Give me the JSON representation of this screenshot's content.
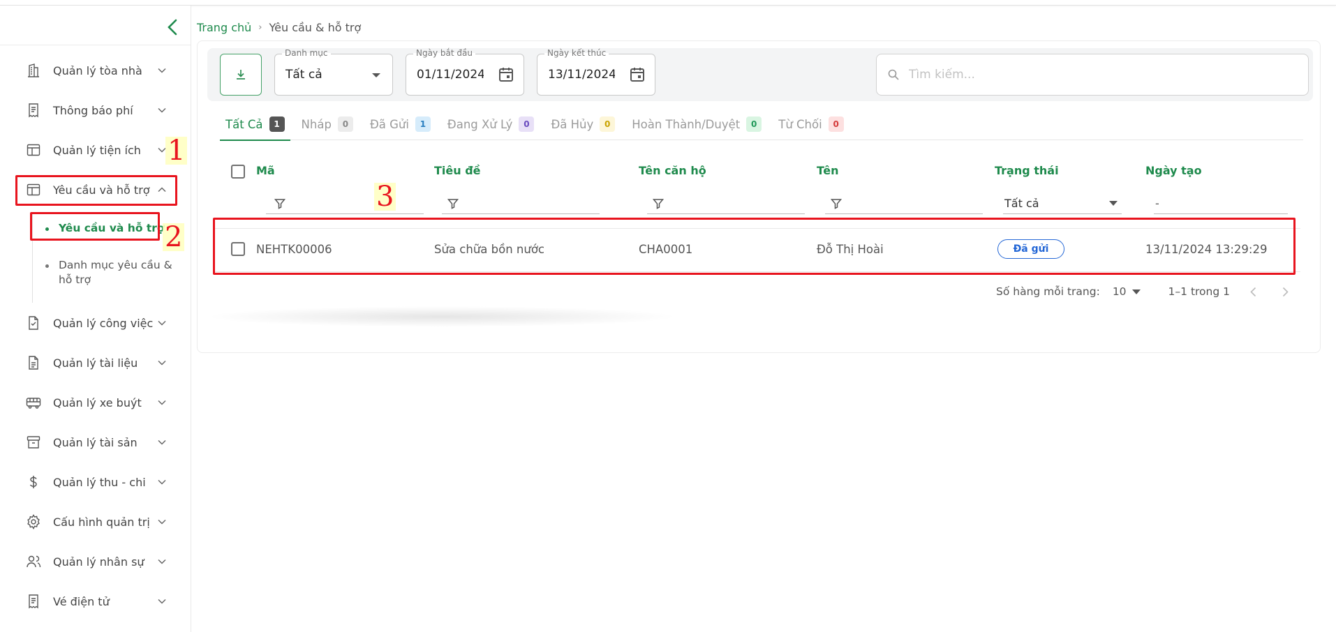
{
  "sidebar": {
    "items": [
      {
        "label": "Quản lý tòa nhà",
        "icon": "building-icon"
      },
      {
        "label": "Thông báo phí",
        "icon": "receipt-icon"
      },
      {
        "label": "Quản lý tiện ích",
        "icon": "layout-icon"
      },
      {
        "label": "Yêu cầu và hỗ trợ",
        "icon": "layout-icon"
      },
      {
        "label": "Quản lý công việc",
        "icon": "file-check-icon"
      },
      {
        "label": "Quản lý tài liệu",
        "icon": "document-icon"
      },
      {
        "label": "Quản lý xe buýt",
        "icon": "bus-icon"
      },
      {
        "label": "Quản lý tài sản",
        "icon": "archive-icon"
      },
      {
        "label": "Quản lý thu - chi",
        "icon": "dollar-icon"
      },
      {
        "label": "Cấu hình quản trị",
        "icon": "gear-icon"
      },
      {
        "label": "Quản lý nhân sự",
        "icon": "users-icon"
      },
      {
        "label": "Vé điện tử",
        "icon": "receipt-icon"
      }
    ],
    "sub_items": [
      {
        "label": "Yêu cầu và hỗ trợ",
        "active": true
      },
      {
        "label": "Danh mục yêu cầu & hỗ trợ",
        "active": false
      }
    ]
  },
  "annotations": [
    "1",
    "2",
    "3"
  ],
  "breadcrumb": {
    "home": "Trang chủ",
    "separator": "›",
    "current": "Yêu cầu & hỗ trợ"
  },
  "filters": {
    "category_label": "Danh mục",
    "category_value": "Tất cả",
    "start_label": "Ngày bắt đầu",
    "start_value": "01/11/2024",
    "end_label": "Ngày kết thúc",
    "end_value": "13/11/2024",
    "search_placeholder": "Tìm kiếm..."
  },
  "tabs": [
    {
      "label": "Tất Cả",
      "count": "1",
      "bg": "#555555",
      "fg": "#ffffff"
    },
    {
      "label": "Nháp",
      "count": "0",
      "bg": "#ececec",
      "fg": "#888888"
    },
    {
      "label": "Đã Gửi",
      "count": "1",
      "bg": "#d6ecfb",
      "fg": "#2a7fc0"
    },
    {
      "label": "Đang Xử Lý",
      "count": "0",
      "bg": "#e8e0f7",
      "fg": "#6a4bbf"
    },
    {
      "label": "Đã Hủy",
      "count": "0",
      "bg": "#fdf6d8",
      "fg": "#c9a300"
    },
    {
      "label": "Hoàn Thành/Duyệt",
      "count": "0",
      "bg": "#d9f5e2",
      "fg": "#22995a"
    },
    {
      "label": "Từ Chối",
      "count": "0",
      "bg": "#fde0e0",
      "fg": "#d43a3a"
    }
  ],
  "table": {
    "headers": {
      "code": "Mã",
      "title": "Tiêu đề",
      "apartment": "Tên căn hộ",
      "name": "Tên",
      "status": "Trạng thái",
      "created": "Ngày tạo"
    },
    "status_filter": "Tất cả",
    "date_filter": "-",
    "rows": [
      {
        "code": "NEHTK00006",
        "title": "Sửa chữa bồn nước",
        "apartment": "CHA0001",
        "name": "Đỗ Thị Hoài",
        "status": "Đã gửi",
        "created": "13/11/2024 13:29:29"
      }
    ]
  },
  "pagination": {
    "rows_per_page_label": "Số hàng mỗi trang:",
    "rows_per_page": "10",
    "range": "1–1 trong 1"
  },
  "colors": {
    "accent": "#1e8a4c",
    "annotation": "#e8141e",
    "status_blue": "#2467d6"
  }
}
